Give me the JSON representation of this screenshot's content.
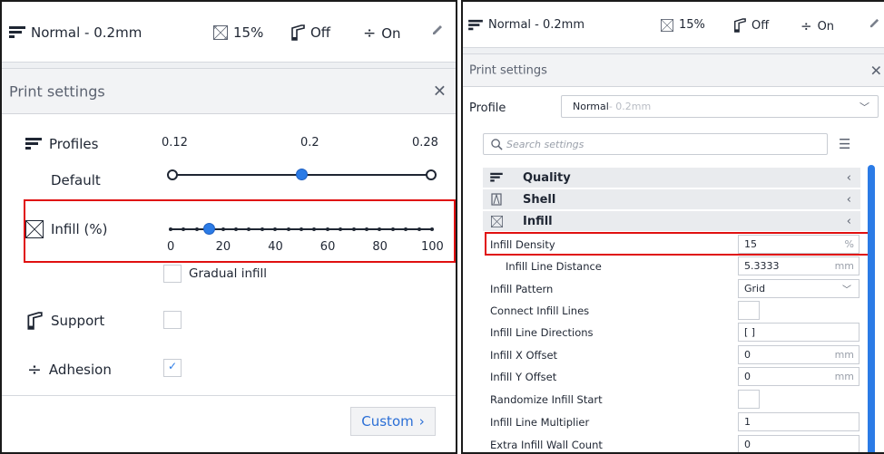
{
  "left": {
    "topbar": {
      "profile_name": "Normal - 0.2mm",
      "infill_value": "15%",
      "support_value": "Off",
      "adhesion_value": "On"
    },
    "print_settings": {
      "title": "Print settings",
      "close_label": "✕"
    },
    "profiles": {
      "label": "Profiles",
      "current": "Default",
      "ticks": [
        "0.12",
        "0.2",
        "0.28"
      ],
      "selected_fraction": 0.5
    },
    "infill": {
      "label": "Infill (%)",
      "ticks": [
        "0",
        "20",
        "40",
        "60",
        "80",
        "100"
      ],
      "value_percent": 15,
      "gradual_label": "Gradual infill",
      "gradual_checked": false
    },
    "support": {
      "label": "Support",
      "checked": false
    },
    "adhesion": {
      "label": "Adhesion",
      "checked": true
    },
    "custom_button": {
      "label": "Custom",
      "chevron": "›"
    }
  },
  "right": {
    "topbar": {
      "profile_name": "Normal - 0.2mm",
      "infill_value": "15%",
      "support_value": "Off",
      "adhesion_value": "On"
    },
    "print_settings": {
      "title": "Print settings",
      "close_label": "✕"
    },
    "profile": {
      "label": "Profile",
      "name": "Normal",
      "sub": " - 0.2mm"
    },
    "search": {
      "placeholder": "Search settings"
    },
    "categories": [
      {
        "label": "Quality",
        "chevron": "‹"
      },
      {
        "label": "Shell",
        "chevron": "‹"
      },
      {
        "label": "Infill",
        "chevron": "‹"
      }
    ],
    "settings": [
      {
        "label": "Infill Density",
        "value": "15",
        "unit": "%"
      },
      {
        "label": "Infill Line Distance",
        "value": "5.3333",
        "unit": "mm"
      },
      {
        "label": "Infill Pattern",
        "value": "Grid",
        "unit": ""
      },
      {
        "label": "Connect Infill Lines",
        "value": "",
        "unit": ""
      },
      {
        "label": "Infill Line Directions",
        "value": "[ ]",
        "unit": ""
      },
      {
        "label": "Infill X Offset",
        "value": "0",
        "unit": "mm"
      },
      {
        "label": "Infill Y Offset",
        "value": "0",
        "unit": "mm"
      },
      {
        "label": "Randomize Infill Start",
        "value": "",
        "unit": ""
      },
      {
        "label": "Infill Line Multiplier",
        "value": "1",
        "unit": ""
      },
      {
        "label": "Extra Infill Wall Count",
        "value": "0",
        "unit": ""
      }
    ]
  },
  "colors": {
    "accent": "#2b7be6",
    "highlight_box": "#e01010",
    "text": "#1f2633",
    "muted": "#5b6270"
  }
}
